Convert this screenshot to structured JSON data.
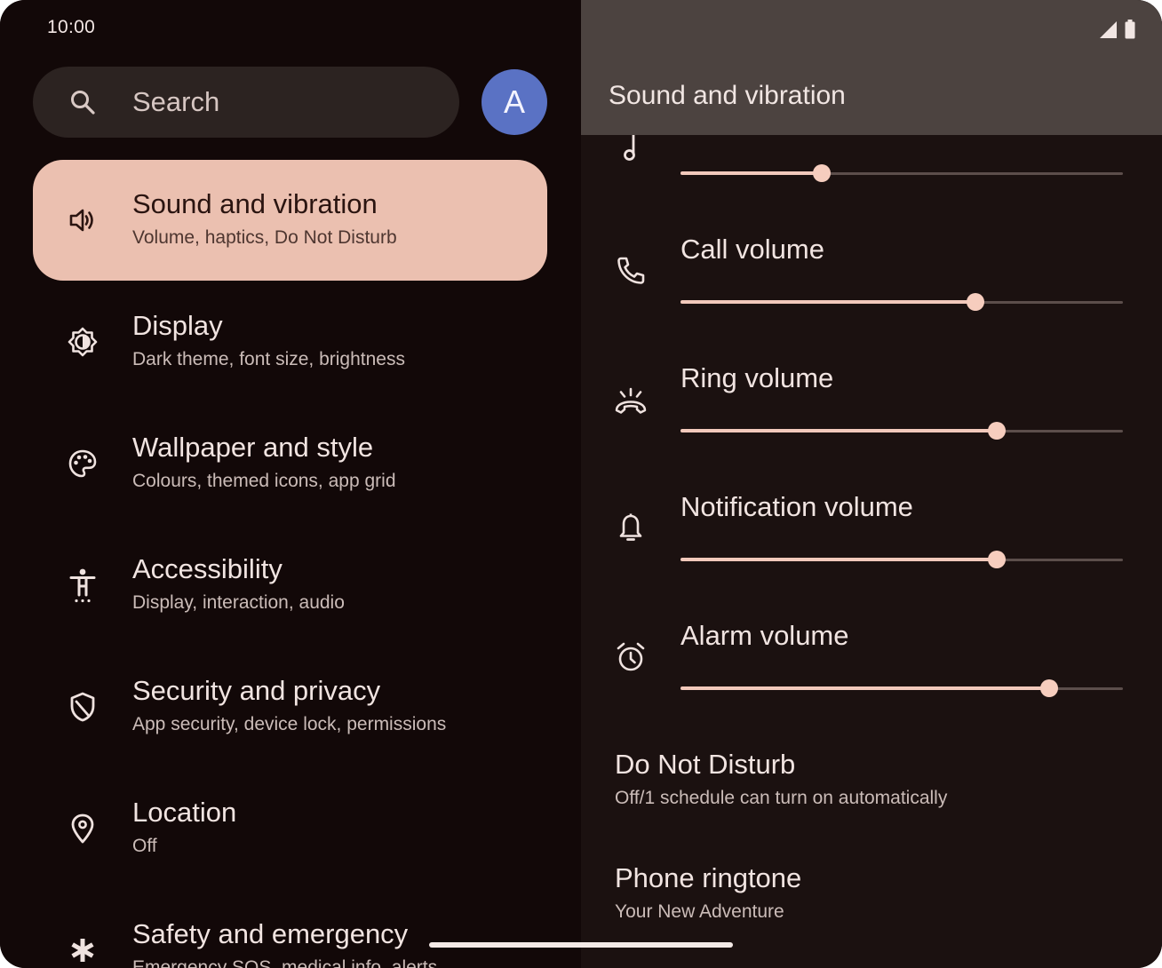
{
  "status_bar": {
    "time": "10:00",
    "icons": [
      "signal-icon",
      "battery-icon"
    ]
  },
  "search": {
    "placeholder": "Search",
    "icon": "search-icon"
  },
  "avatar": {
    "letter": "A",
    "color": "#5a72c4"
  },
  "colors": {
    "selected_item_bg": "#ebc0b0",
    "left_pane_bg": "#120808",
    "right_pane_bg": "#1b1110",
    "header_bg": "#4c4340",
    "slider_active": "#f2c9bb",
    "slider_inactive": "#5c4e4b"
  },
  "sidebar": {
    "items": [
      {
        "title": "Sound and vibration",
        "subtitle": "Volume, haptics, Do Not Disturb",
        "icon": "speaker-icon",
        "selected": true
      },
      {
        "title": "Display",
        "subtitle": "Dark theme, font size, brightness",
        "icon": "brightness-icon",
        "selected": false
      },
      {
        "title": "Wallpaper and style",
        "subtitle": "Colours, themed icons, app grid",
        "icon": "palette-icon",
        "selected": false
      },
      {
        "title": "Accessibility",
        "subtitle": "Display, interaction, audio",
        "icon": "accessibility-icon",
        "selected": false
      },
      {
        "title": "Security and privacy",
        "subtitle": "App security, device lock, permissions",
        "icon": "shield-icon",
        "selected": false
      },
      {
        "title": "Location",
        "subtitle": "Off",
        "icon": "location-pin-icon",
        "selected": false
      },
      {
        "title": "Safety and emergency",
        "subtitle": "Emergency SOS, medical info, alerts",
        "icon": "asterisk-icon",
        "selected": false
      }
    ]
  },
  "detail": {
    "title": "Sound and vibration",
    "volumes": [
      {
        "label": "",
        "icon": "music-note-icon",
        "level": 0.32
      },
      {
        "label": "Call volume",
        "icon": "phone-icon",
        "level": 0.667
      },
      {
        "label": "Ring volume",
        "icon": "ring-icon",
        "level": 0.714
      },
      {
        "label": "Notification volume",
        "icon": "bell-icon",
        "level": 0.714
      },
      {
        "label": "Alarm volume",
        "icon": "alarm-clock-icon",
        "level": 0.833
      }
    ],
    "do_not_disturb": {
      "title": "Do Not Disturb",
      "subtitle": "Off/1 schedule can turn on automatically"
    },
    "ringtone": {
      "title": "Phone ringtone",
      "subtitle": "Your New Adventure"
    }
  }
}
